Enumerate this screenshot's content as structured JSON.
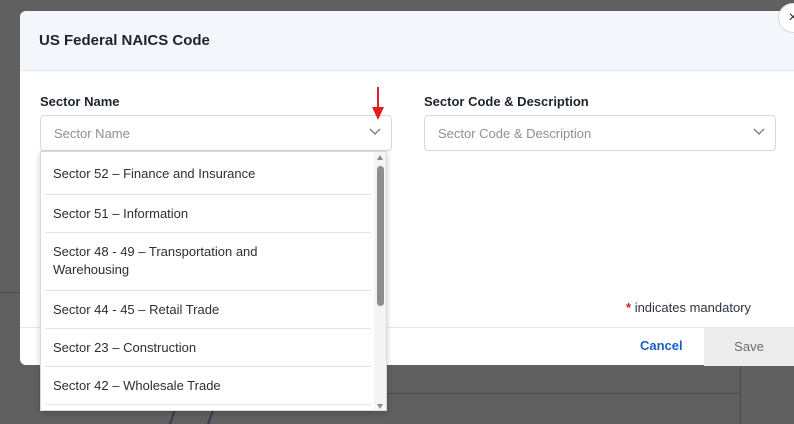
{
  "modal": {
    "title": "US Federal NAICS Code",
    "close_glyph": "×"
  },
  "fields": {
    "sector_name": {
      "label": "Sector Name",
      "placeholder": "Sector Name"
    },
    "sector_code": {
      "label": "Sector Code & Description",
      "placeholder": "Sector Code & Description"
    }
  },
  "dropdown": {
    "options": [
      "Sector 52 – Finance and Insurance",
      "Sector 51 – Information",
      "Sector 48 - 49 – Transportation and Warehousing",
      "Sector 44 - 45 – Retail Trade",
      "Sector 23 – Construction",
      "Sector 42 – Wholesale Trade"
    ]
  },
  "mandatory_note": {
    "star": "*",
    "text": "indicates mandatory"
  },
  "footer": {
    "cancel_label": "Cancel",
    "save_label": "Save"
  },
  "colors": {
    "annotation_arrow": "#e02020",
    "link_blue": "#1a5fc2",
    "required_star": "#d61e1e"
  }
}
